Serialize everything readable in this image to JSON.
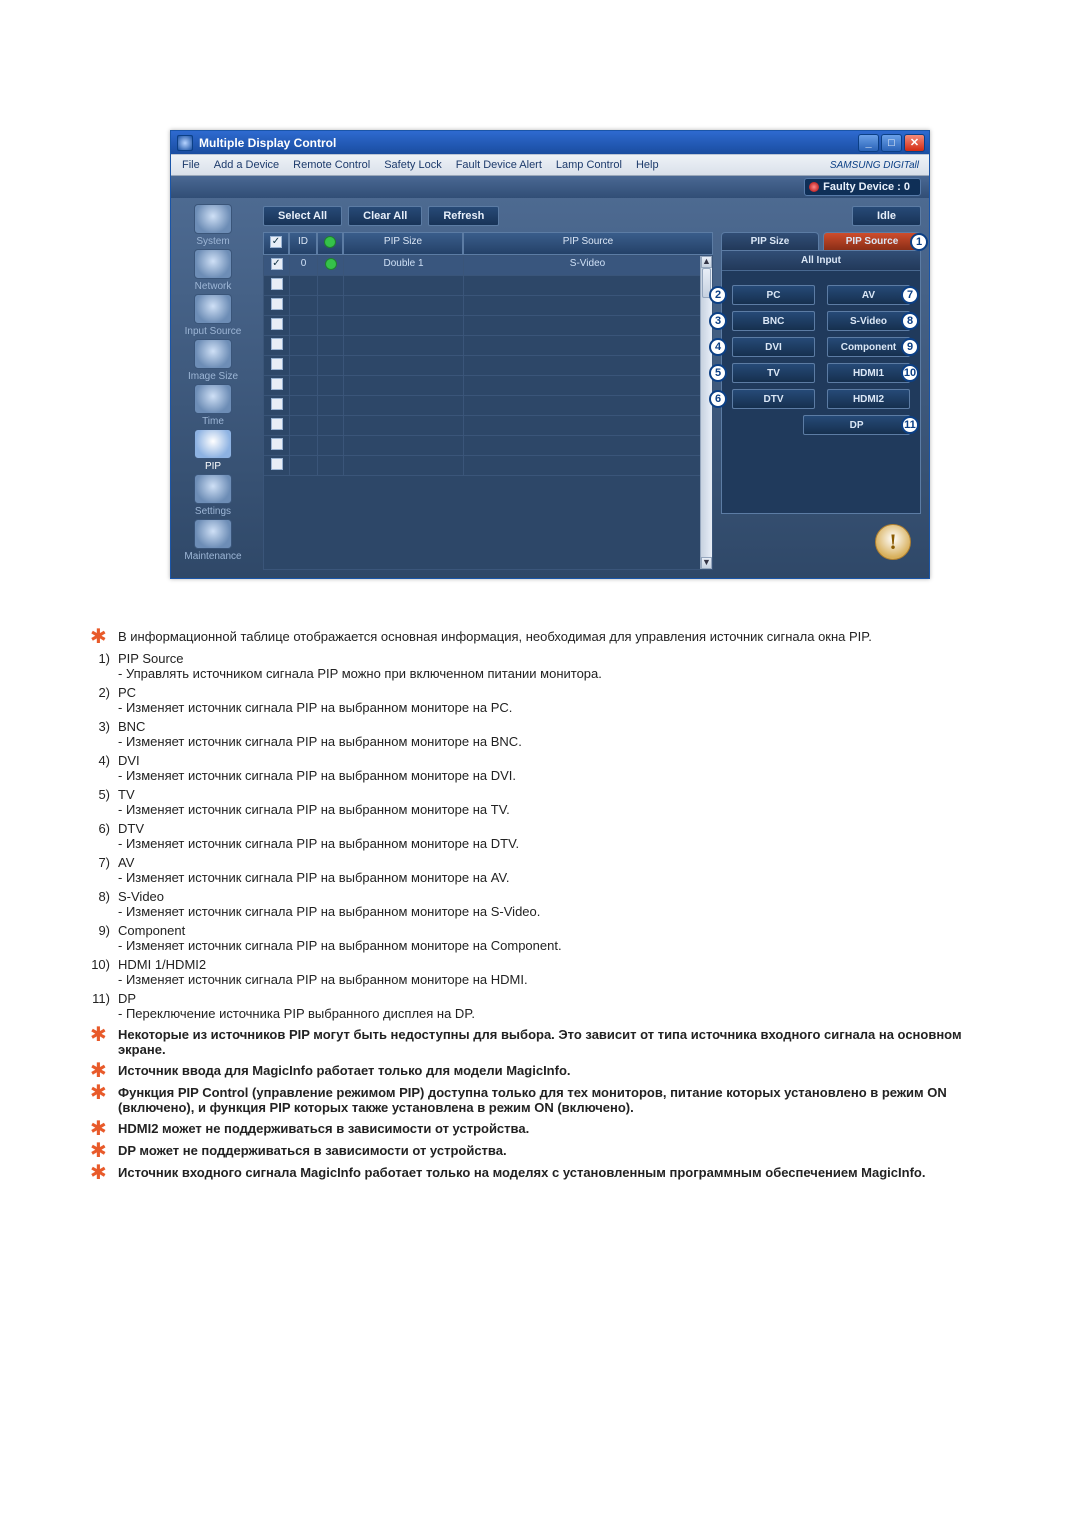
{
  "window": {
    "title": "Multiple Display Control",
    "brand": "SAMSUNG DIGITall"
  },
  "menu": {
    "file": "File",
    "add_device": "Add a Device",
    "remote_control": "Remote Control",
    "safety_lock": "Safety Lock",
    "fault_device_alert": "Fault Device Alert",
    "lamp_control": "Lamp Control",
    "help": "Help"
  },
  "faulty_chip": "Faulty Device : 0",
  "actions": {
    "select_all": "Select All",
    "clear_all": "Clear All",
    "refresh": "Refresh"
  },
  "status": "Idle",
  "sidebar": {
    "items": [
      "System",
      "Network",
      "Input Source",
      "Image Size",
      "Time",
      "PIP",
      "Settings",
      "Maintenance"
    ]
  },
  "grid": {
    "head": {
      "c1": "",
      "c2": "ID",
      "c3": "",
      "c4": "PIP Size",
      "c5": "PIP Source"
    },
    "row": {
      "id": "0",
      "pip_size": "Double 1",
      "pip_source": "S-Video"
    }
  },
  "tabs": {
    "pip_size": "PIP Size",
    "pip_source": "PIP Source",
    "badge1": "1"
  },
  "all_input": "All Input",
  "buttons": {
    "pc": {
      "label": "PC",
      "num": "2"
    },
    "av": {
      "label": "AV",
      "num": "7"
    },
    "bnc": {
      "label": "BNC",
      "num": "3"
    },
    "svid": {
      "label": "S-Video",
      "num": "8"
    },
    "dvi": {
      "label": "DVI",
      "num": "4"
    },
    "comp": {
      "label": "Component",
      "num": "9"
    },
    "tv": {
      "label": "TV",
      "num": "5"
    },
    "hdmi1": {
      "label": "HDMI1",
      "num": "10"
    },
    "dtv": {
      "label": "DTV",
      "num": "6"
    },
    "hdmi2": {
      "label": "HDMI2",
      "num": ""
    },
    "dp": {
      "label": "DP",
      "num": "11"
    }
  },
  "notes": {
    "intro": "В информационной таблице отображается основная информация, необходимая для управления источник сигнала окна PIP.",
    "foot1": "Некоторые из источников PIP могут быть недоступны для выбора. Это зависит от типа источника входного сигнала на основном экране.",
    "foot2": "Источник ввода для MagicInfo работает только для модели MagicInfo.",
    "foot3": "Функция PIP Control (управление режимом PIP) доступна только для тех мониторов, питание которых установлено в режим ON (включено), и функция PIP которых также установлена в режим ON (включено).",
    "foot4": "HDMI2 может не поддерживаться в зависимости от устройства.",
    "foot5": "DP может не поддерживаться в зависимости от устройства.",
    "foot6": "Источник входного сигнала MagicInfo работает только на моделях с установленным программным обеспечением MagicInfo."
  },
  "items": [
    {
      "n": "1)",
      "title": "PIP Source",
      "desc": "- Управлять источником сигнала PIP можно при включенном питании монитора."
    },
    {
      "n": "2)",
      "title": "PC",
      "desc": "- Изменяет источник сигнала PIP на выбранном мониторе на PC."
    },
    {
      "n": "3)",
      "title": "BNC",
      "desc": "- Изменяет источник сигнала PIP на выбранном мониторе на BNC."
    },
    {
      "n": "4)",
      "title": "DVI",
      "desc": "- Изменяет источник сигнала PIP на выбранном мониторе на DVI."
    },
    {
      "n": "5)",
      "title": "TV",
      "desc": "- Изменяет источник сигнала PIP на выбранном мониторе на TV."
    },
    {
      "n": "6)",
      "title": "DTV",
      "desc": "- Изменяет источник сигнала PIP на выбранном мониторе на DTV."
    },
    {
      "n": "7)",
      "title": "AV",
      "desc": "- Изменяет источник сигнала PIP на выбранном мониторе на AV."
    },
    {
      "n": "8)",
      "title": "S-Video",
      "desc": "- Изменяет источник сигнала PIP на выбранном мониторе на S-Video."
    },
    {
      "n": "9)",
      "title": "Component",
      "desc": "- Изменяет источник сигнала PIP на выбранном мониторе на Component."
    },
    {
      "n": "10)",
      "title": "HDMI 1/HDMI2",
      "desc": "- Изменяет источник сигнала PIP на выбранном мониторе на HDMI."
    },
    {
      "n": "11)",
      "title": "DP",
      "desc": "- Переключение источника PIP выбранного дисплея на DP."
    }
  ]
}
